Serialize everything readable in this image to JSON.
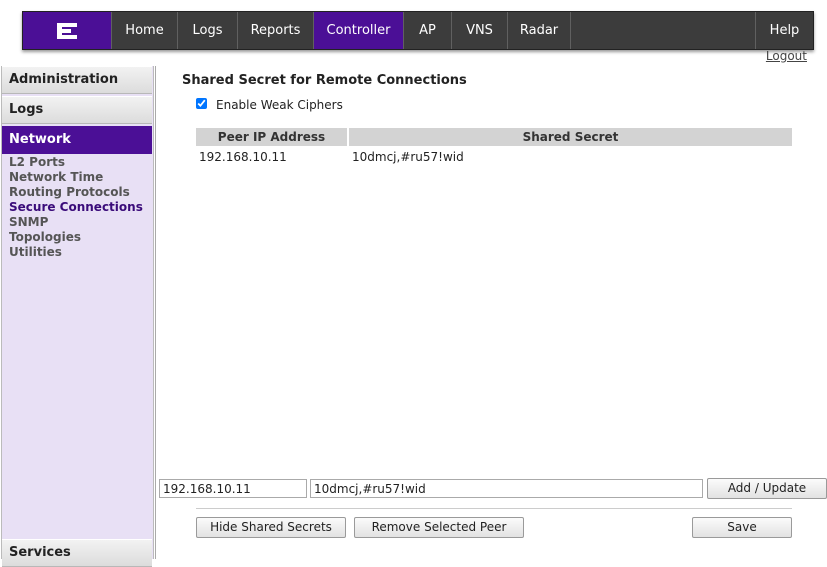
{
  "nav": {
    "items": [
      "Home",
      "Logs",
      "Reports",
      "Controller",
      "AP",
      "VNS",
      "Radar"
    ],
    "active": "Controller",
    "help": "Help",
    "logout": "Logout"
  },
  "sidebar": {
    "sections": [
      "Administration",
      "Logs",
      "Network"
    ],
    "active_section": "Network",
    "network_items": [
      "L2 Ports",
      "Network Time",
      "Routing Protocols",
      "Secure Connections",
      "SNMP",
      "Topologies",
      "Utilities"
    ],
    "selected_item": "Secure Connections",
    "bottom_section": "Services"
  },
  "main": {
    "title": "Shared Secret for Remote Connections",
    "weak_ciphers_label": "Enable Weak Ciphers",
    "weak_ciphers_checked": true,
    "table": {
      "headers": [
        "Peer IP Address",
        "Shared Secret"
      ],
      "rows": [
        [
          "192.168.10.11",
          "10dmcj,#ru57!wid"
        ]
      ]
    },
    "ip_input": "192.168.10.11",
    "secret_input": "10dmcj,#ru57!wid",
    "add_update": "Add / Update",
    "hide_secrets": "Hide Shared Secrets",
    "remove_peer": "Remove Selected Peer",
    "save": "Save"
  },
  "colors": {
    "accent": "#4b0f96",
    "navbar": "#3c3c3c",
    "sidebar_bg": "#e8e0f5"
  }
}
